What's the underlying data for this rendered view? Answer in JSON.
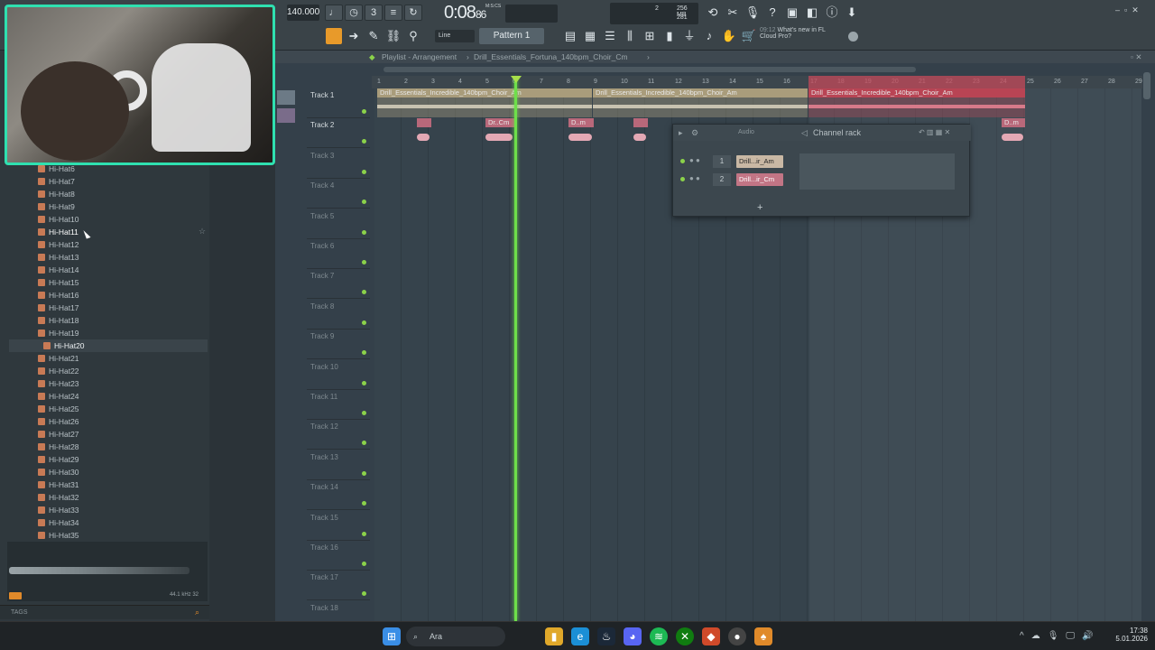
{
  "transport": {
    "tempo": "140.000",
    "time": "0:08",
    "time_small": "86",
    "time_label": "M:S:CS",
    "cpu": "2",
    "mem": "256 MB",
    "mem2": "281"
  },
  "toolbar": {
    "snap": "Line",
    "pattern": "Pattern 1",
    "news_time": "09:12",
    "news_text": "What's new in FL",
    "news_text2": "Cloud Pro?"
  },
  "breadcrumb": {
    "prefix": "Playlist - Arrangement",
    "sep": "›",
    "name": "Drill_Essentials_Fortuna_140bpm_Choir_Cm",
    "end": "›"
  },
  "browser": {
    "items": [
      "Hi-Hat6",
      "Hi-Hat7",
      "Hi-Hat8",
      "Hi-Hat9",
      "Hi-Hat10",
      "Hi-Hat11",
      "Hi-Hat12",
      "Hi-Hat13",
      "Hi-Hat14",
      "Hi-Hat15",
      "Hi-Hat16",
      "Hi-Hat17",
      "Hi-Hat18",
      "Hi-Hat19",
      "Hi-Hat20",
      "Hi-Hat21",
      "Hi-Hat22",
      "Hi-Hat23",
      "Hi-Hat24",
      "Hi-Hat25",
      "Hi-Hat26",
      "Hi-Hat27",
      "Hi-Hat28",
      "Hi-Hat29",
      "Hi-Hat30",
      "Hi-Hat31",
      "Hi-Hat32",
      "Hi-Hat33",
      "Hi-Hat34",
      "Hi-Hat35"
    ],
    "selected": "Hi-Hat20",
    "hovered": "Hi-Hat11",
    "sample_info": "44.1 kHz 32",
    "tags_label": "TAGS"
  },
  "ruler": [
    "1",
    "2",
    "3",
    "4",
    "5",
    "6",
    "7",
    "8",
    "9",
    "10",
    "11",
    "12",
    "13",
    "14",
    "15",
    "16",
    "17",
    "18",
    "19",
    "20",
    "21",
    "22",
    "23",
    "24",
    "25",
    "26",
    "27",
    "28",
    "29"
  ],
  "tracks": [
    "Track 1",
    "Track 2",
    "Track 3",
    "Track 4",
    "Track 5",
    "Track 6",
    "Track 7",
    "Track 8",
    "Track 9",
    "Track 10",
    "Track 11",
    "Track 12",
    "Track 13",
    "Track 14",
    "Track 15",
    "Track 16",
    "Track 17",
    "Track 18"
  ],
  "clips": {
    "track1": [
      "Drill_Essentials_Incredible_140bpm_Choir_Am",
      "Drill_Essentials_Incredible_140bpm_Choir_Am",
      "Drill_Essentials_Incredible_140bpm_Choir_Am"
    ],
    "track2": [
      "Dr..Cm",
      "D..m",
      "Dri..Cm",
      "D..m",
      "D..m",
      "D..m"
    ]
  },
  "channel_rack": {
    "title": "Channel rack",
    "filter": "Audio",
    "channels": [
      {
        "num": "1",
        "name": "Drill...ir_Am"
      },
      {
        "num": "2",
        "name": "Drill...ir_Cm"
      }
    ],
    "add": "+"
  },
  "taskbar": {
    "search": "Ara",
    "time": "17:38",
    "date": "5.01.2026"
  },
  "colors": {
    "accent": "#f0a830",
    "clip_green": "#bfb28e",
    "clip_red": "#c34a5a",
    "playhead": "#6ee04a",
    "webcam_border": "#2fe0b0"
  }
}
